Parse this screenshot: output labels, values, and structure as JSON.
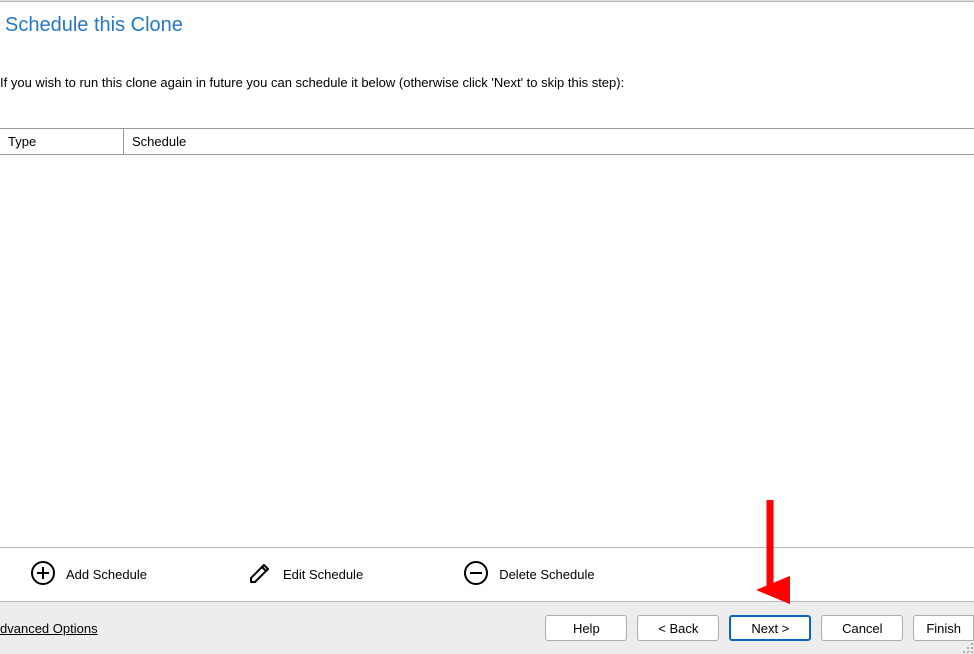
{
  "header": {
    "title": "Schedule this Clone"
  },
  "description": "If you wish to run this clone again in future you can schedule it below (otherwise click 'Next' to skip this step):",
  "table": {
    "headers": {
      "type": "Type",
      "schedule": "Schedule"
    }
  },
  "actions": {
    "add": "Add Schedule",
    "edit": "Edit Schedule",
    "delete": "Delete Schedule"
  },
  "footer": {
    "advanced": "dvanced Options",
    "help": "Help",
    "back": "< Back",
    "next": "Next >",
    "cancel": "Cancel",
    "finish": "Finish"
  }
}
